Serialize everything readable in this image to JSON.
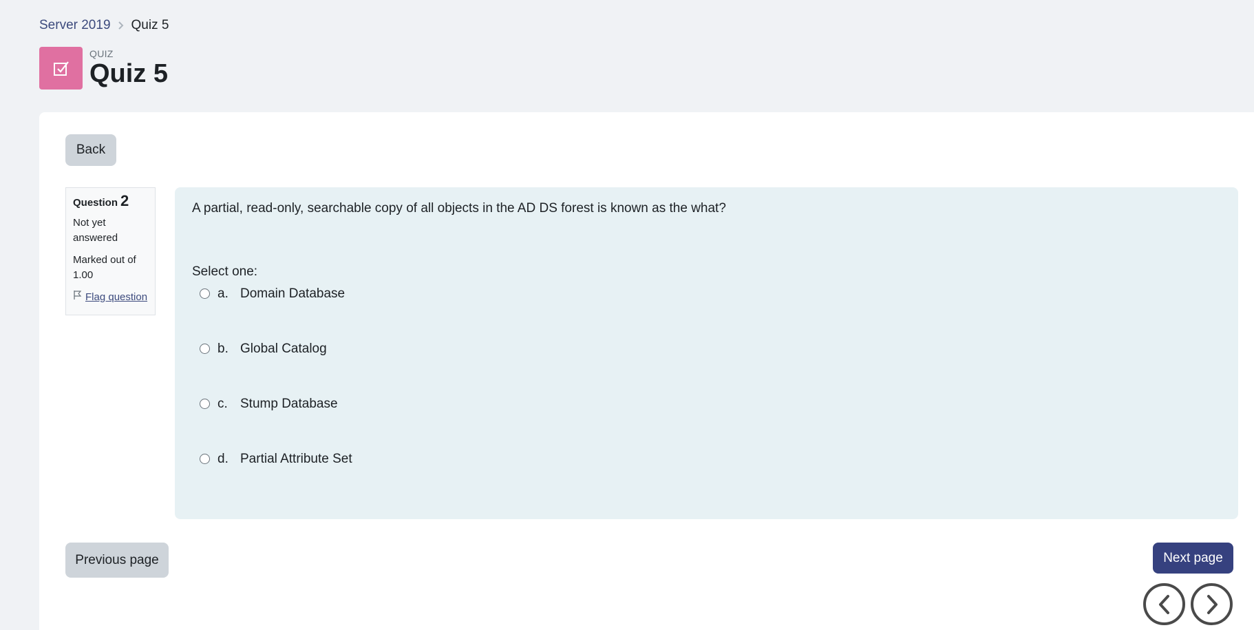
{
  "breadcrumb": {
    "course": "Server 2019",
    "current": "Quiz 5"
  },
  "header": {
    "activity_type": "QUIZ",
    "title": "Quiz 5",
    "icon": "quiz-checkbox-icon",
    "icon_color": "#e070a1"
  },
  "back_button": "Back",
  "question_info": {
    "label": "Question",
    "number": "2",
    "state": "Not yet answered",
    "grade": "Marked out of 1.00",
    "flag_label": "Flag question"
  },
  "question": {
    "text": "A partial, read-only, searchable copy of all objects in the AD DS forest is known as the what?",
    "prompt": "Select one:",
    "answers": [
      {
        "letter": "a.",
        "text": "Domain Database"
      },
      {
        "letter": "b.",
        "text": "Global Catalog"
      },
      {
        "letter": "c.",
        "text": "Stump Database"
      },
      {
        "letter": "d.",
        "text": "Partial Attribute Set"
      }
    ]
  },
  "navigation": {
    "previous": "Previous page",
    "next": "Next page",
    "arrow_left_icon": "chevron-left-icon",
    "arrow_right_icon": "chevron-right-icon"
  },
  "colors": {
    "primary": "#36417f",
    "secondary": "#ced4da",
    "question_bg": "#e7f1f4",
    "page_bg": "#f0f2f5"
  }
}
